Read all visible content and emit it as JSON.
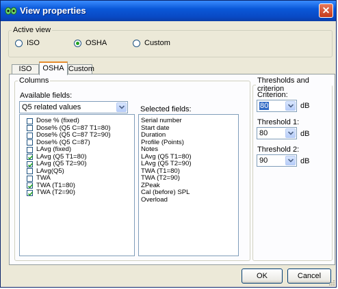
{
  "window": {
    "title": "View properties",
    "close_label": "✕"
  },
  "active_view": {
    "legend": "Active view",
    "options": [
      {
        "label": "ISO",
        "selected": false
      },
      {
        "label": "OSHA",
        "selected": true
      },
      {
        "label": "Custom",
        "selected": false
      }
    ]
  },
  "tabs": [
    {
      "label": "ISO",
      "active": false
    },
    {
      "label": "OSHA",
      "active": true
    },
    {
      "label": "Custom",
      "active": false
    }
  ],
  "columns": {
    "legend": "Columns",
    "available_label": "Available fields:",
    "category": "Q5 related values",
    "available_fields": [
      {
        "label": "Dose % (fixed)",
        "checked": false
      },
      {
        "label": "Dose% (Q5 C=87 T1=80)",
        "checked": false
      },
      {
        "label": "Dose% (Q5 C=87 T2=90)",
        "checked": false
      },
      {
        "label": "Dose% (Q5 C=87)",
        "checked": false
      },
      {
        "label": "LAvg (fixed)",
        "checked": false
      },
      {
        "label": "LAvg (Q5 T1=80)",
        "checked": true
      },
      {
        "label": "LAvg (Q5 T2=90)",
        "checked": true
      },
      {
        "label": "LAvg(Q5)",
        "checked": false
      },
      {
        "label": "TWA",
        "checked": false
      },
      {
        "label": "TWA (T1=80)",
        "checked": true
      },
      {
        "label": "TWA (T2=90)",
        "checked": true
      }
    ],
    "selected_label": "Selected fields:",
    "selected_fields": [
      "Serial number",
      "Start date",
      "Duration",
      "Profile (Points)",
      "Notes",
      "LAvg (Q5 T1=80)",
      "LAvg (Q5 T2=90)",
      "TWA (T1=80)",
      "TWA (T2=90)",
      "ZPeak",
      "Cal (before) SPL",
      "Overload"
    ]
  },
  "thresholds": {
    "legend": "Thresholds and criterion",
    "criterion": {
      "label": "Criterion:",
      "value": "80",
      "unit": "dB"
    },
    "threshold1": {
      "label": "Threshold 1:",
      "value": "80",
      "unit": "dB"
    },
    "threshold2": {
      "label": "Threshold 2:",
      "value": "90",
      "unit": "dB"
    }
  },
  "buttons": {
    "ok": "OK",
    "cancel": "Cancel"
  },
  "colors": {
    "titlebar": "#0a58d8",
    "tab_accent": "#e68b2c",
    "selection": "#316ac5",
    "radio_dot": "#21a121"
  }
}
